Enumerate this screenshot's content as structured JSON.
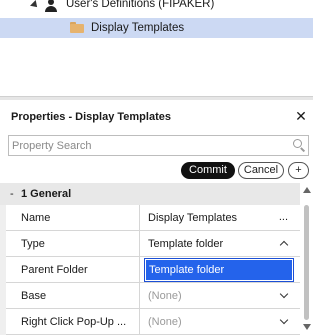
{
  "tree": {
    "items": [
      {
        "label": "User's Definitions (FIPAKER)",
        "icon": "user-icon"
      },
      {
        "label": "Display Templates",
        "icon": "folder-icon",
        "selected": true
      }
    ]
  },
  "panel": {
    "title": "Properties - Display Templates",
    "close_label": "✕",
    "search_placeholder": "Property Search",
    "commit_label": "Commit",
    "cancel_label": "Cancel",
    "add_label": "+",
    "group": {
      "toggle": "-",
      "title": "1 General"
    },
    "rows": [
      {
        "name": "Name",
        "value": "Display Templates",
        "control": "..."
      },
      {
        "name": "Type",
        "value": "Template folder",
        "control": "chevron-up-icon"
      },
      {
        "name": "Parent Folder",
        "value": "",
        "control": ""
      },
      {
        "name": "Base",
        "value": "(None)",
        "control": "chevron-down-icon"
      },
      {
        "name": "Right Click Pop-Up ...",
        "value": "(None)",
        "control": "chevron-down-icon"
      }
    ],
    "dropdown": {
      "open": true,
      "options": [
        "Template folder"
      ],
      "selected": "Template folder"
    }
  },
  "colors": {
    "selection": "#ccd9f3",
    "dropdown_highlight": "#2463eb",
    "commit_bg": "#111111"
  }
}
